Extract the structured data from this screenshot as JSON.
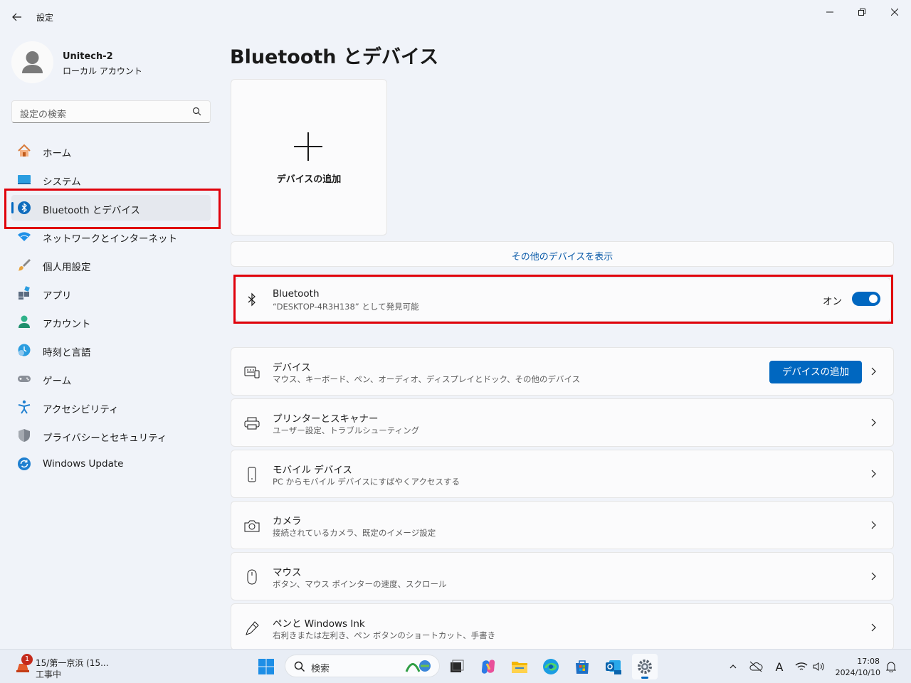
{
  "window": {
    "app_title": "設定",
    "minimize_glyph": "—",
    "restore_glyph": "❐",
    "close_glyph": "✕"
  },
  "profile": {
    "name": "Unitech-2",
    "account_type": "ローカル アカウント"
  },
  "search": {
    "placeholder": "設定の検索"
  },
  "sidebar": {
    "items": [
      {
        "label": "ホーム",
        "icon": "home-icon"
      },
      {
        "label": "システム",
        "icon": "system-icon"
      },
      {
        "label": "Bluetooth とデバイス",
        "icon": "bluetooth-icon",
        "active": true
      },
      {
        "label": "ネットワークとインターネット",
        "icon": "wifi-icon"
      },
      {
        "label": "個人用設定",
        "icon": "brush-icon"
      },
      {
        "label": "アプリ",
        "icon": "apps-icon"
      },
      {
        "label": "アカウント",
        "icon": "account-icon"
      },
      {
        "label": "時刻と言語",
        "icon": "time-language-icon"
      },
      {
        "label": "ゲーム",
        "icon": "gamepad-icon"
      },
      {
        "label": "アクセシビリティ",
        "icon": "accessibility-icon"
      },
      {
        "label": "プライバシーとセキュリティ",
        "icon": "shield-icon"
      },
      {
        "label": "Windows Update",
        "icon": "update-icon"
      }
    ]
  },
  "main": {
    "title": "Bluetooth とデバイス",
    "add_tile_label": "デバイスの追加",
    "show_more": "その他のデバイスを表示",
    "bluetooth": {
      "title": "Bluetooth",
      "subtitle": "“DESKTOP-4R3H138” として発見可能",
      "state_label": "オン",
      "enabled": true
    },
    "rows": [
      {
        "title": "デバイス",
        "subtitle": "マウス、キーボード、ペン、オーディオ、ディスプレイとドック、その他のデバイス",
        "icon": "devices-icon",
        "button": "デバイスの追加"
      },
      {
        "title": "プリンターとスキャナー",
        "subtitle": "ユーザー設定、トラブルシューティング",
        "icon": "printer-icon"
      },
      {
        "title": "モバイル デバイス",
        "subtitle": "PC からモバイル デバイスにすばやくアクセスする",
        "icon": "phone-icon"
      },
      {
        "title": "カメラ",
        "subtitle": "接続されているカメラ、既定のイメージ設定",
        "icon": "camera-icon"
      },
      {
        "title": "マウス",
        "subtitle": "ボタン、マウス ポインターの速度、スクロール",
        "icon": "mouse-icon"
      },
      {
        "title": "ペンと Windows Ink",
        "subtitle": "右利きまたは左利き、ペン ボタンのショートカット、手書き",
        "icon": "pen-icon"
      }
    ]
  },
  "taskbar": {
    "weather_line1": "15/第一京浜 (15...",
    "weather_line2": "工事中",
    "weather_badge": "1",
    "search_placeholder": "検索",
    "ime_label": "A",
    "time": "17:08",
    "date": "2024/10/10"
  },
  "colors": {
    "accent": "#0067c0",
    "highlight_box": "#e0000b"
  }
}
